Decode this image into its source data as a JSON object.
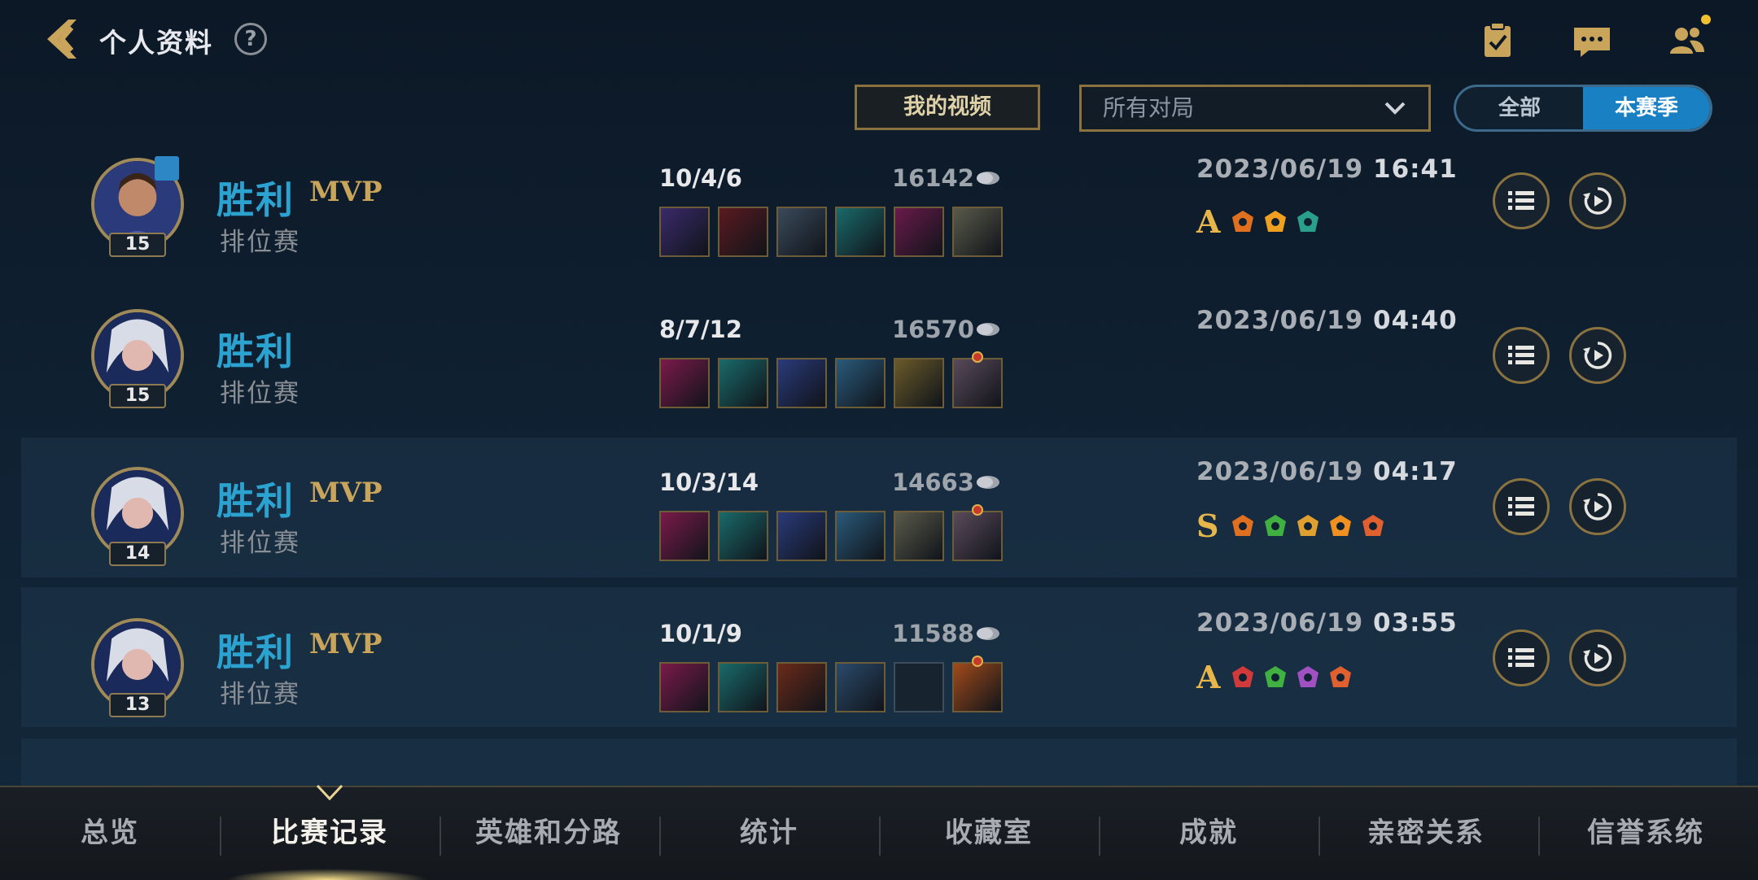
{
  "header": {
    "title": "个人资料",
    "help_label": "?"
  },
  "filters": {
    "video_button": "我的视频",
    "match_select": "所有对局",
    "season_toggle": {
      "all": "全部",
      "season": "本赛季",
      "selected": "本赛季"
    }
  },
  "matches": [
    {
      "result": "胜利",
      "mvp": "MVP",
      "mode": "排位赛",
      "level": "15",
      "kda": "10/4/6",
      "gold": "16142",
      "date": "2023/06/19",
      "time": "16:41",
      "grade": "A",
      "items": [
        "#3a2a6a",
        "#5a1a20",
        "#3a4a5a",
        "#1a6a6a",
        "#6a1a4a",
        "#5a5a4a"
      ],
      "badges": [
        "#e07020",
        "#f0a020",
        "#2aa08a"
      ]
    },
    {
      "result": "胜利",
      "mvp": "",
      "mode": "排位赛",
      "level": "15",
      "kda": "8/7/12",
      "gold": "16570",
      "date": "2023/06/19",
      "time": "04:40",
      "grade": "",
      "items": [
        "#7a1a4a",
        "#1a6a6a",
        "#2a3a7a",
        "#2a5a7a",
        "#6a5a2a",
        "#5a4a5a"
      ],
      "badges": []
    },
    {
      "result": "胜利",
      "mvp": "MVP",
      "mode": "排位赛",
      "level": "14",
      "kda": "10/3/14",
      "gold": "14663",
      "date": "2023/06/19",
      "time": "04:17",
      "grade": "S",
      "items": [
        "#7a1a4a",
        "#1a6a6a",
        "#2a3a7a",
        "#2a5a7a",
        "#5a5a4a",
        "#5a4a5a"
      ],
      "badges": [
        "#e07020",
        "#40b040",
        "#e0a030",
        "#f09020",
        "#e06030"
      ]
    },
    {
      "result": "胜利",
      "mvp": "MVP",
      "mode": "排位赛",
      "level": "13",
      "kda": "10/1/9",
      "gold": "11588",
      "date": "2023/06/19",
      "time": "03:55",
      "grade": "A",
      "items": [
        "#7a1a4a",
        "#1a6a6a",
        "#6a2a1a",
        "#2a4a6a",
        "",
        "#a04a1a"
      ],
      "badges": [
        "#d03a3a",
        "#40b040",
        "#a050c0",
        "#e06030"
      ]
    }
  ],
  "tabs": [
    "总览",
    "比赛记录",
    "英雄和分路",
    "统计",
    "收藏室",
    "成就",
    "亲密关系",
    "信誉系统"
  ],
  "active_tab": "比赛记录",
  "colors": {
    "accent_blue": "#2ba2cf",
    "gold": "#c9a45b",
    "toggle_active": "#1a80c4"
  }
}
